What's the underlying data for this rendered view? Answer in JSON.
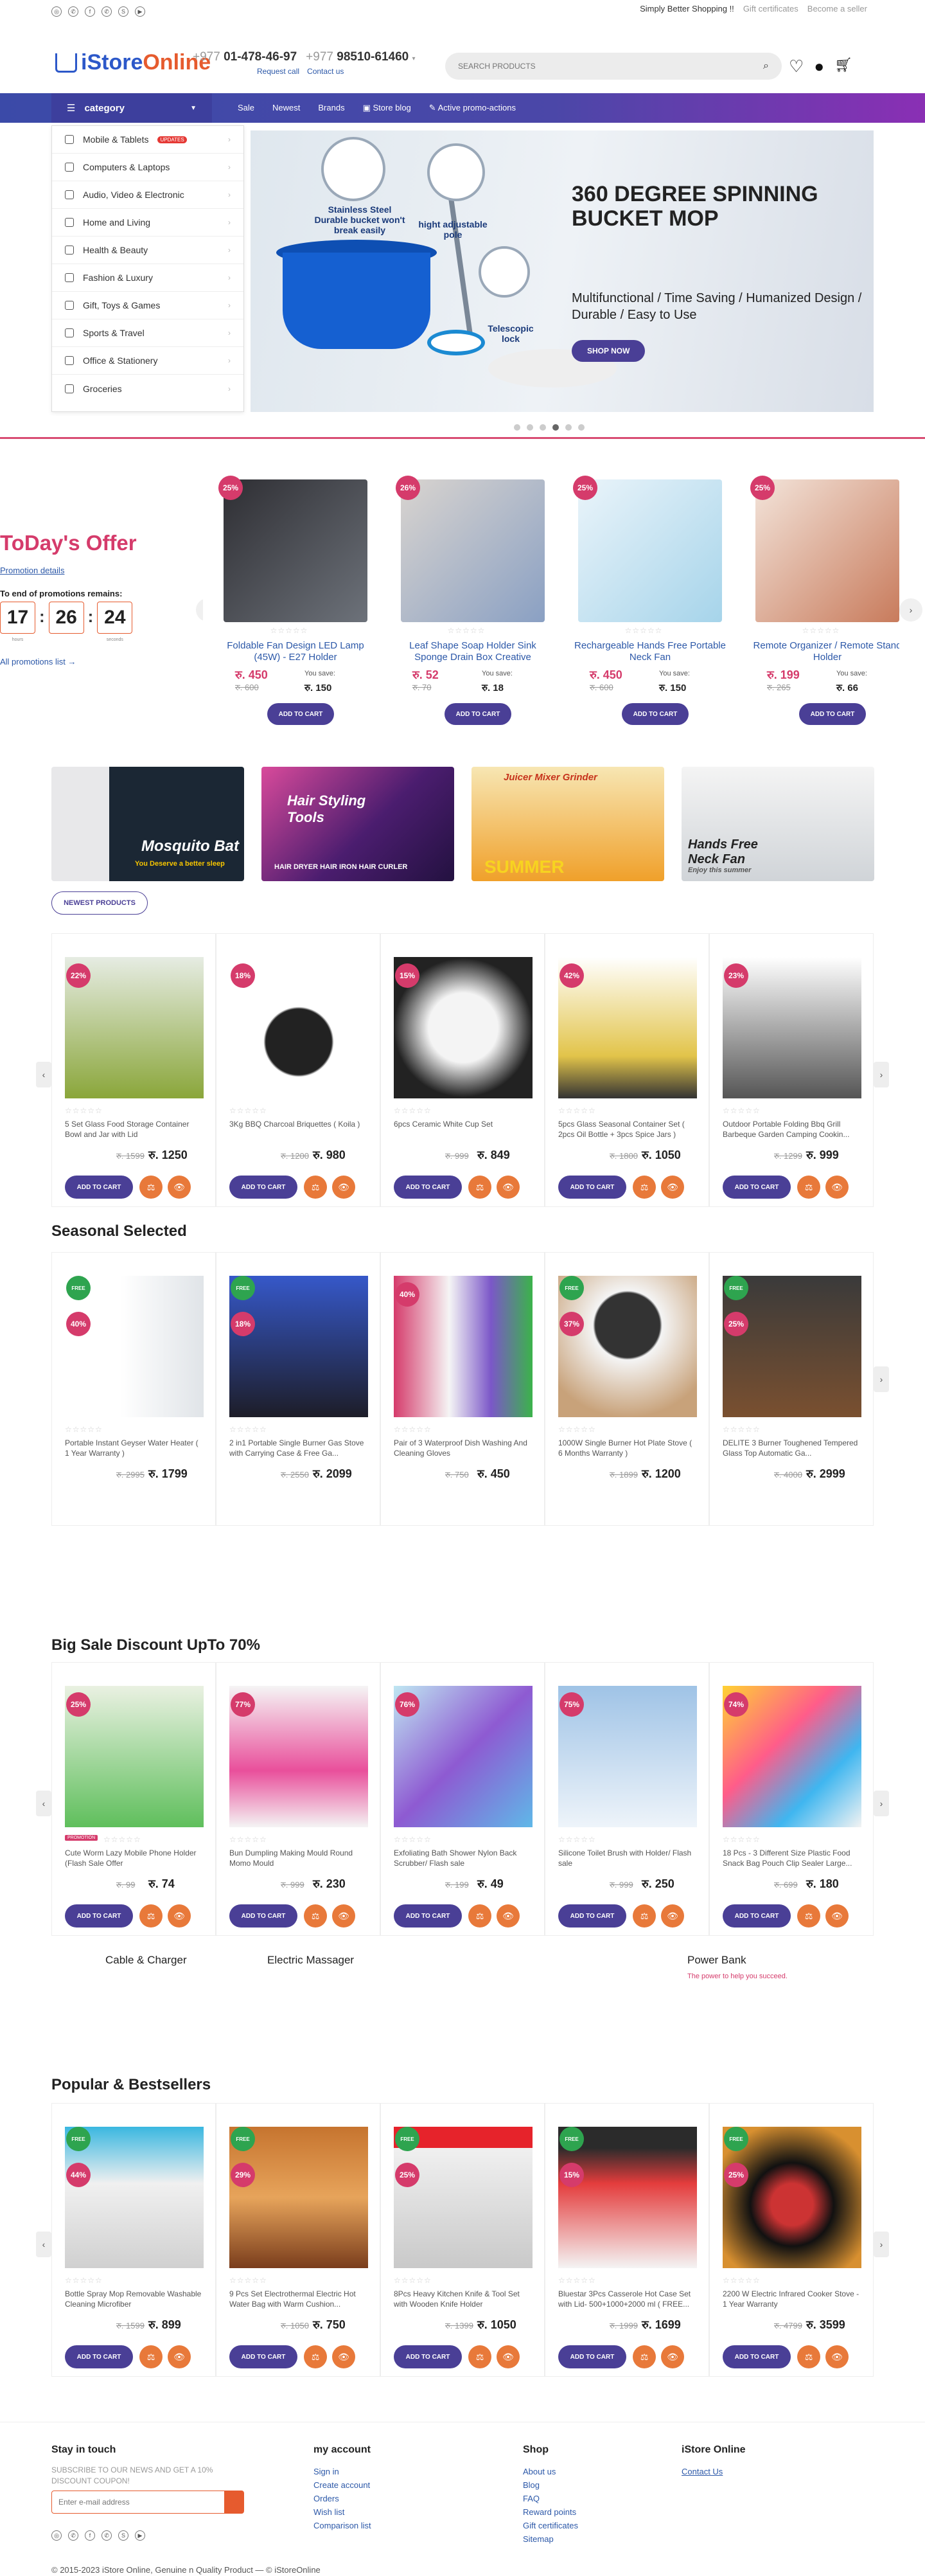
{
  "topbar": {
    "social": [
      "instagram-icon",
      "whatsapp-icon",
      "facebook-icon",
      "viber-icon",
      "skype-icon",
      "youtube-icon"
    ],
    "tagline": "Simply Better Shopping !!",
    "gift": "Gift certificates",
    "seller": "Become a seller"
  },
  "header": {
    "logo": {
      "part1": "iStore",
      "part2": "Online"
    },
    "phone1_prefix": "+977",
    "phone1": "01-478-46-97",
    "phone2_prefix": "+977",
    "phone2": "98510-61460",
    "request_call": "Request call",
    "contact_us": "Contact us",
    "search_placeholder": "SEARCH PRODUCTS"
  },
  "nav": {
    "category": "category",
    "links": [
      "Sale",
      "Newest",
      "Brands",
      "Store blog",
      "Active promo-actions"
    ]
  },
  "categories": [
    {
      "label": "Mobile & Tablets",
      "badge": "UPDATES"
    },
    {
      "label": "Computers & Laptops"
    },
    {
      "label": "Audio, Video & Electronic"
    },
    {
      "label": "Home and Living"
    },
    {
      "label": "Health & Beauty"
    },
    {
      "label": "Fashion & Luxury"
    },
    {
      "label": "Gift, Toys & Games"
    },
    {
      "label": "Sports & Travel"
    },
    {
      "label": "Office & Stationery"
    },
    {
      "label": "Groceries"
    }
  ],
  "hero": {
    "title": "360 DEGREE SPINNING BUCKET MOP",
    "subtitle": "Multifunctional / Time Saving / Humanized Design / Durable / Easy to Use",
    "shop": "SHOP NOW",
    "label1": "Stainless Steel Durable bucket won't break easily",
    "label2": "hight adjustable pole",
    "label3": "Telescopic lock",
    "slides": 6,
    "active_slide": 4
  },
  "offer": {
    "title": "ToDay's Offer",
    "details": "Promotion details",
    "countdown_label": "To end of promotions remains:",
    "timer": {
      "d": "17",
      "h": "26",
      "m": "24"
    },
    "timer_labels": {
      "d": "hours",
      "h": "",
      "m": "seconds"
    },
    "all_promos": "All promotions list →",
    "items": [
      {
        "pct": "25%",
        "name": "Foldable Fan Design LED Lamp (45W) - E27 Holder",
        "price": "रु. 450",
        "old": "रु. 600",
        "save_label": "You save:",
        "save": "रु. 150"
      },
      {
        "pct": "26%",
        "name": "Leaf Shape Soap Holder Sink Sponge Drain Box Creative",
        "price": "रु. 52",
        "old": "रु. 70",
        "save_label": "You save:",
        "save": "रु. 18"
      },
      {
        "pct": "25%",
        "name": "Rechargeable Hands Free Portable Neck Fan",
        "price": "रु. 450",
        "old": "रु. 600",
        "save_label": "You save:",
        "save": "रु. 150"
      },
      {
        "pct": "25%",
        "name": "Remote Organizer / Remote Stand Holder",
        "price": "रु. 199",
        "old": "रु. 265",
        "save_label": "You save:",
        "save": "रु. 66"
      }
    ],
    "atc": "ADD TO CART"
  },
  "banners": [
    {
      "t1": "Mosquito Bat",
      "t2": "You Deserve a better sleep"
    },
    {
      "t1": "Hair Styling Tools",
      "t2": "HAIR DRYER  HAIR IRON  HAIR CURLER"
    },
    {
      "t1": "Juicer Mixer Grinder",
      "t2": "SUMMER"
    },
    {
      "t1": "Hands Free Neck Fan",
      "t2": "Enjoy this summer"
    }
  ],
  "newest": {
    "button": "NEWEST PRODUCTS",
    "items": [
      {
        "pct": "22%",
        "name": "5 Set Glass Food Storage Container Bowl and Jar with Lid",
        "old": "रु. 1599",
        "price": "रु. 1250"
      },
      {
        "pct": "18%",
        "name": "3Kg BBQ Charcoal Briquettes ( Koila )",
        "old": "रु. 1200",
        "price": "रु. 980"
      },
      {
        "pct": "15%",
        "name": "6pcs Ceramic White Cup Set",
        "old": "रु. 999",
        "price": "रु. 849"
      },
      {
        "pct": "42%",
        "name": "5pcs Glass Seasonal Container Set ( 2pcs Oil Bottle + 3pcs Spice Jars )",
        "old": "रु. 1800",
        "price": "रु. 1050"
      },
      {
        "pct": "23%",
        "name": "Outdoor Portable Folding Bbq Grill Barbeque Garden Camping Cookin...",
        "old": "रु. 1299",
        "price": "रु. 999"
      }
    ]
  },
  "seasonal": {
    "title": "Seasonal Selected",
    "items": [
      {
        "pct": "40%",
        "free": "FREE",
        "name": "Portable Instant Geyser Water Heater ( 1 Year Warranty )",
        "old": "रु. 2995",
        "price": "रु. 1799"
      },
      {
        "pct": "18%",
        "free": "FREE",
        "name": "2 in1 Portable Single Burner Gas Stove with Carrying Case & Free Ga...",
        "old": "रु. 2550",
        "price": "रु. 2099"
      },
      {
        "pct": "40%",
        "name": "Pair of 3 Waterproof Dish Washing And Cleaning Gloves",
        "old": "रु. 750",
        "price": "रु. 450"
      },
      {
        "pct": "37%",
        "free": "FREE",
        "name": "1000W Single Burner Hot Plate Stove ( 6 Months Warranty )",
        "old": "रु. 1899",
        "price": "रु. 1200"
      },
      {
        "pct": "25%",
        "free": "FREE",
        "name": "DELITE 3 Burner Toughened Tempered Glass Top Automatic Ga...",
        "old": "रु. 4000",
        "price": "रु. 2999"
      }
    ]
  },
  "bigsale": {
    "title": "Big Sale Discount UpTo 70%",
    "items": [
      {
        "pct": "25%",
        "promo": "PROMOTION",
        "name": "Cute Worm Lazy Mobile Phone Holder (Flash Sale Offer",
        "old": "रु. 99",
        "price": "रु. 74"
      },
      {
        "pct": "77%",
        "name": "Bun Dumpling Making Mould Round Momo Mould",
        "old": "रु. 999",
        "price": "रु. 230"
      },
      {
        "pct": "76%",
        "name": "Exfoliating Bath Shower Nylon Back Scrubber/ Flash sale",
        "old": "रु. 199",
        "price": "रु. 49"
      },
      {
        "pct": "75%",
        "name": "Silicone Toilet Brush with Holder/ Flash sale",
        "old": "रु. 999",
        "price": "रु. 250"
      },
      {
        "pct": "74%",
        "name": "18 Pcs - 3 Different Size Plastic Food Snack Bag Pouch Clip Sealer Large...",
        "old": "रु. 699",
        "price": "रु. 180"
      }
    ]
  },
  "catlabels": {
    "a": "Cable & Charger",
    "b": "Electric Massager",
    "c": "Power Bank",
    "c_sub": "The power to help you succeed."
  },
  "popular": {
    "title": "Popular & Bestsellers",
    "items": [
      {
        "pct": "44%",
        "free": "FREE",
        "name": "Bottle Spray Mop Removable Washable Cleaning Microfiber",
        "old": "रु. 1599",
        "price": "रु. 899"
      },
      {
        "pct": "29%",
        "free": "FREE",
        "name": "9 Pcs Set Electrothermal Electric Hot Water Bag with Warm Cushion...",
        "old": "रु. 1050",
        "price": "रु. 750"
      },
      {
        "pct": "25%",
        "free": "FREE",
        "name": "8Pcs Heavy Kitchen Knife & Tool Set with Wooden Knife Holder",
        "old": "रु. 1399",
        "price": "रु. 1050"
      },
      {
        "pct": "15%",
        "free": "FREE",
        "name": "Bluestar 3Pcs Casserole Hot Case Set with Lid- 500+1000+2000 ml ( FREE...",
        "old": "रु. 1999",
        "price": "रु. 1699"
      },
      {
        "pct": "25%",
        "free": "FREE",
        "name": "2200 W Electric Infrared Cooker Stove - 1 Year Warranty",
        "old": "रु. 4799",
        "price": "रु. 3599"
      }
    ]
  },
  "footer": {
    "touch": "Stay in touch",
    "touch_text": "SUBSCRIBE TO OUR NEWS AND GET A 10% DISCOUNT COUPON!",
    "email_placeholder": "Enter e-mail address",
    "account": "my account",
    "account_links": [
      "Sign in",
      "Create account",
      "Orders",
      "Wish list",
      "Comparison list"
    ],
    "shop": "Shop",
    "shop_links": [
      "About us",
      "Blog",
      "FAQ",
      "Reward points",
      "Gift certificates",
      "Sitemap"
    ],
    "istore": "iStore Online",
    "istore_links": [
      "Contact Us"
    ],
    "copyright": "© 2015-2023 iStore Online, Genuine n Quality Product — © iStoreOnline"
  },
  "colors": {
    "brand": "#2c58c9",
    "accent": "#d53b6b",
    "purple": "#4a3f96",
    "orange": "#e8793a"
  }
}
